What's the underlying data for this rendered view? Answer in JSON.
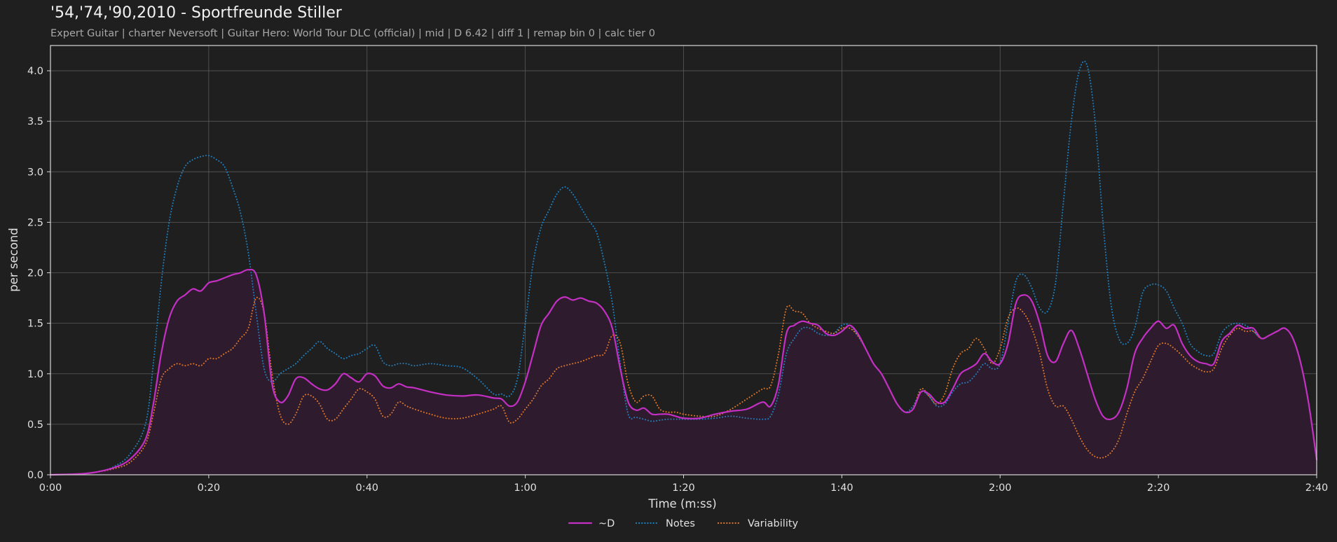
{
  "title": "'54,'74,'90,2010 - Sportfreunde Stiller",
  "subtitle": "Expert Guitar  |  charter Neversoft  |  Guitar Hero: World Tour DLC (official)  |  mid  |  D 6.42  |  diff 1  |  remap bin 0  |  calc tier 0",
  "colors": {
    "background": "#1f1f1f",
    "grid": "#5a5a5a",
    "d": "#c42fc4",
    "d_fill": "#2e1c2e",
    "notes": "#1f7fbf",
    "variability": "#e0762a"
  },
  "chart_data": {
    "type": "line",
    "xlabel": "Time (m:ss)",
    "ylabel": "per second",
    "xlim": [
      0,
      160
    ],
    "ylim": [
      0,
      4.25
    ],
    "grid": true,
    "legend_position": "bottom-center",
    "x_ticks": [
      0,
      20,
      40,
      60,
      80,
      100,
      120,
      140,
      160
    ],
    "x_tick_labels": [
      "0:00",
      "0:20",
      "0:40",
      "1:00",
      "1:20",
      "1:40",
      "2:00",
      "2:20",
      "2:40"
    ],
    "y_ticks": [
      0,
      0.5,
      1.0,
      1.5,
      2.0,
      2.5,
      3.0,
      3.5,
      4.0
    ],
    "y_tick_labels": [
      "0.0",
      "0.5",
      "1.0",
      "1.5",
      "2.0",
      "2.5",
      "3.0",
      "3.5",
      "4.0"
    ],
    "series": [
      {
        "name": "~D",
        "style": "solid",
        "color": "#c42fc4",
        "x": [
          0,
          4,
          6,
          8,
          10,
          12,
          13,
          14,
          15,
          16,
          17,
          18,
          19,
          20,
          21,
          22,
          23,
          24,
          25,
          26,
          27,
          28,
          29,
          30,
          31,
          32,
          33,
          34,
          35,
          36,
          37,
          38,
          39,
          40,
          41,
          42,
          43,
          44,
          45,
          46,
          48,
          50,
          52,
          54,
          56,
          57,
          58,
          59,
          60,
          61,
          62,
          63,
          64,
          65,
          66,
          67,
          68,
          69,
          70,
          71,
          72,
          73,
          74,
          75,
          76,
          77,
          78,
          79,
          80,
          82,
          84,
          86,
          88,
          90,
          91,
          92,
          93,
          94,
          95,
          96,
          97,
          98,
          99,
          100,
          101,
          102,
          103,
          104,
          105,
          106,
          107,
          108,
          109,
          110,
          111,
          112,
          113,
          114,
          115,
          116,
          117,
          118,
          119,
          120,
          121,
          122,
          123,
          124,
          125,
          126,
          127,
          128,
          129,
          130,
          131,
          132,
          133,
          134,
          135,
          136,
          137,
          138,
          139,
          140,
          141,
          142,
          143,
          144,
          145,
          146,
          147,
          148,
          149,
          150,
          151,
          152,
          153,
          154,
          155,
          156,
          157,
          158,
          159,
          160
        ],
        "y": [
          0,
          0.01,
          0.03,
          0.07,
          0.15,
          0.35,
          0.7,
          1.2,
          1.55,
          1.72,
          1.78,
          1.84,
          1.82,
          1.9,
          1.92,
          1.95,
          1.98,
          2.0,
          2.03,
          1.98,
          1.6,
          0.9,
          0.72,
          0.78,
          0.95,
          0.96,
          0.9,
          0.85,
          0.84,
          0.9,
          1.0,
          0.96,
          0.92,
          1.0,
          0.98,
          0.88,
          0.86,
          0.9,
          0.87,
          0.86,
          0.82,
          0.79,
          0.78,
          0.79,
          0.76,
          0.75,
          0.68,
          0.72,
          0.92,
          1.2,
          1.48,
          1.6,
          1.72,
          1.76,
          1.73,
          1.75,
          1.72,
          1.7,
          1.62,
          1.45,
          1.05,
          0.72,
          0.64,
          0.66,
          0.6,
          0.6,
          0.6,
          0.58,
          0.56,
          0.56,
          0.6,
          0.63,
          0.65,
          0.72,
          0.68,
          0.9,
          1.4,
          1.48,
          1.52,
          1.5,
          1.48,
          1.4,
          1.38,
          1.42,
          1.48,
          1.4,
          1.25,
          1.1,
          1.0,
          0.85,
          0.7,
          0.62,
          0.65,
          0.82,
          0.8,
          0.72,
          0.72,
          0.85,
          1.0,
          1.05,
          1.1,
          1.2,
          1.12,
          1.1,
          1.3,
          1.7,
          1.78,
          1.72,
          1.5,
          1.18,
          1.12,
          1.3,
          1.43,
          1.25,
          1.0,
          0.75,
          0.58,
          0.55,
          0.62,
          0.85,
          1.2,
          1.35,
          1.45,
          1.52,
          1.45,
          1.48,
          1.3,
          1.18,
          1.12,
          1.1,
          1.1,
          1.32,
          1.4,
          1.48,
          1.45,
          1.45,
          1.35,
          1.38,
          1.42,
          1.45,
          1.35,
          1.1,
          0.7,
          0.15
        ]
      },
      {
        "name": "Notes",
        "style": "dotted",
        "color": "#1f7fbf",
        "x": [
          0,
          4,
          6,
          8,
          10,
          12,
          13,
          14,
          15,
          16,
          17,
          18,
          19,
          20,
          21,
          22,
          23,
          24,
          25,
          26,
          27,
          28,
          29,
          30,
          31,
          32,
          33,
          34,
          35,
          36,
          37,
          38,
          39,
          40,
          41,
          42,
          43,
          44,
          45,
          46,
          48,
          50,
          52,
          54,
          56,
          57,
          58,
          59,
          60,
          61,
          62,
          63,
          64,
          65,
          66,
          67,
          68,
          69,
          70,
          71,
          72,
          73,
          74,
          75,
          76,
          77,
          78,
          79,
          80,
          82,
          84,
          86,
          88,
          90,
          91,
          92,
          93,
          94,
          95,
          96,
          97,
          98,
          99,
          100,
          101,
          102,
          103,
          104,
          105,
          106,
          107,
          108,
          109,
          110,
          111,
          112,
          113,
          114,
          115,
          116,
          117,
          118,
          119,
          120,
          121,
          122,
          123,
          124,
          125,
          126,
          127,
          128,
          129,
          130,
          131,
          132,
          133,
          134,
          135,
          136,
          137,
          138,
          139,
          140,
          141,
          142,
          143,
          144,
          145,
          146,
          147,
          148,
          149,
          150,
          151,
          152,
          153,
          154,
          155,
          156,
          157,
          158,
          159,
          160
        ],
        "y": [
          0,
          0.01,
          0.03,
          0.08,
          0.2,
          0.5,
          1.1,
          1.9,
          2.5,
          2.85,
          3.05,
          3.12,
          3.15,
          3.16,
          3.12,
          3.05,
          2.85,
          2.6,
          2.2,
          1.6,
          1.05,
          0.92,
          1.0,
          1.05,
          1.1,
          1.18,
          1.25,
          1.32,
          1.25,
          1.2,
          1.15,
          1.18,
          1.2,
          1.25,
          1.28,
          1.12,
          1.08,
          1.1,
          1.1,
          1.08,
          1.1,
          1.08,
          1.06,
          0.95,
          0.8,
          0.8,
          0.78,
          0.95,
          1.5,
          2.1,
          2.45,
          2.62,
          2.78,
          2.85,
          2.78,
          2.65,
          2.52,
          2.4,
          2.1,
          1.7,
          1.1,
          0.6,
          0.57,
          0.55,
          0.53,
          0.54,
          0.55,
          0.55,
          0.55,
          0.55,
          0.56,
          0.58,
          0.56,
          0.55,
          0.58,
          0.8,
          1.2,
          1.35,
          1.45,
          1.45,
          1.4,
          1.38,
          1.4,
          1.48,
          1.48,
          1.38,
          1.25,
          1.1,
          1.0,
          0.85,
          0.7,
          0.62,
          0.68,
          0.82,
          0.78,
          0.68,
          0.7,
          0.82,
          0.9,
          0.92,
          1.0,
          1.1,
          1.05,
          1.1,
          1.5,
          1.92,
          1.98,
          1.85,
          1.65,
          1.62,
          1.9,
          2.7,
          3.5,
          4.0,
          4.05,
          3.5,
          2.5,
          1.7,
          1.35,
          1.3,
          1.45,
          1.8,
          1.88,
          1.88,
          1.82,
          1.65,
          1.5,
          1.3,
          1.22,
          1.18,
          1.2,
          1.4,
          1.48,
          1.5,
          1.48,
          1.42,
          1.35,
          1.38,
          1.42,
          1.45,
          1.35,
          1.1,
          0.7,
          0.15
        ]
      },
      {
        "name": "Variability",
        "style": "dotted",
        "color": "#e0762a",
        "x": [
          0,
          4,
          6,
          8,
          10,
          12,
          13,
          14,
          15,
          16,
          17,
          18,
          19,
          20,
          21,
          22,
          23,
          24,
          25,
          26,
          27,
          28,
          29,
          30,
          31,
          32,
          33,
          34,
          35,
          36,
          37,
          38,
          39,
          40,
          41,
          42,
          43,
          44,
          45,
          46,
          48,
          50,
          52,
          54,
          56,
          57,
          58,
          59,
          60,
          61,
          62,
          63,
          64,
          65,
          66,
          67,
          68,
          69,
          70,
          71,
          72,
          73,
          74,
          75,
          76,
          77,
          78,
          79,
          80,
          82,
          84,
          86,
          88,
          90,
          91,
          92,
          93,
          94,
          95,
          96,
          97,
          98,
          99,
          100,
          101,
          102,
          103,
          104,
          105,
          106,
          107,
          108,
          109,
          110,
          111,
          112,
          113,
          114,
          115,
          116,
          117,
          118,
          119,
          120,
          121,
          122,
          123,
          124,
          125,
          126,
          127,
          128,
          129,
          130,
          131,
          132,
          133,
          134,
          135,
          136,
          137,
          138,
          139,
          140,
          141,
          142,
          143,
          144,
          145,
          146,
          147,
          148,
          149,
          150,
          151,
          152,
          153,
          154,
          155,
          156,
          157,
          158,
          159,
          160
        ],
        "y": [
          0,
          0.01,
          0.03,
          0.06,
          0.12,
          0.3,
          0.6,
          0.95,
          1.05,
          1.1,
          1.08,
          1.1,
          1.08,
          1.15,
          1.15,
          1.2,
          1.25,
          1.35,
          1.45,
          1.75,
          1.6,
          1.0,
          0.6,
          0.5,
          0.6,
          0.78,
          0.78,
          0.7,
          0.55,
          0.55,
          0.65,
          0.75,
          0.85,
          0.82,
          0.75,
          0.58,
          0.6,
          0.72,
          0.68,
          0.65,
          0.6,
          0.56,
          0.56,
          0.6,
          0.65,
          0.68,
          0.52,
          0.55,
          0.65,
          0.75,
          0.88,
          0.95,
          1.05,
          1.08,
          1.1,
          1.12,
          1.15,
          1.18,
          1.2,
          1.38,
          1.3,
          0.9,
          0.72,
          0.78,
          0.78,
          0.65,
          0.62,
          0.62,
          0.6,
          0.58,
          0.58,
          0.65,
          0.75,
          0.85,
          0.88,
          1.2,
          1.65,
          1.62,
          1.6,
          1.5,
          1.45,
          1.42,
          1.4,
          1.45,
          1.45,
          1.38,
          1.25,
          1.1,
          1.0,
          0.85,
          0.7,
          0.62,
          0.65,
          0.85,
          0.78,
          0.7,
          0.8,
          1.05,
          1.2,
          1.25,
          1.35,
          1.25,
          1.1,
          1.25,
          1.55,
          1.65,
          1.6,
          1.45,
          1.2,
          0.85,
          0.68,
          0.68,
          0.55,
          0.38,
          0.25,
          0.18,
          0.17,
          0.22,
          0.35,
          0.6,
          0.82,
          0.95,
          1.12,
          1.28,
          1.3,
          1.25,
          1.18,
          1.1,
          1.05,
          1.02,
          1.05,
          1.25,
          1.38,
          1.45,
          1.42,
          1.42,
          1.35,
          1.38,
          1.42,
          1.45,
          1.35,
          1.1,
          0.7,
          0.15
        ]
      }
    ]
  }
}
